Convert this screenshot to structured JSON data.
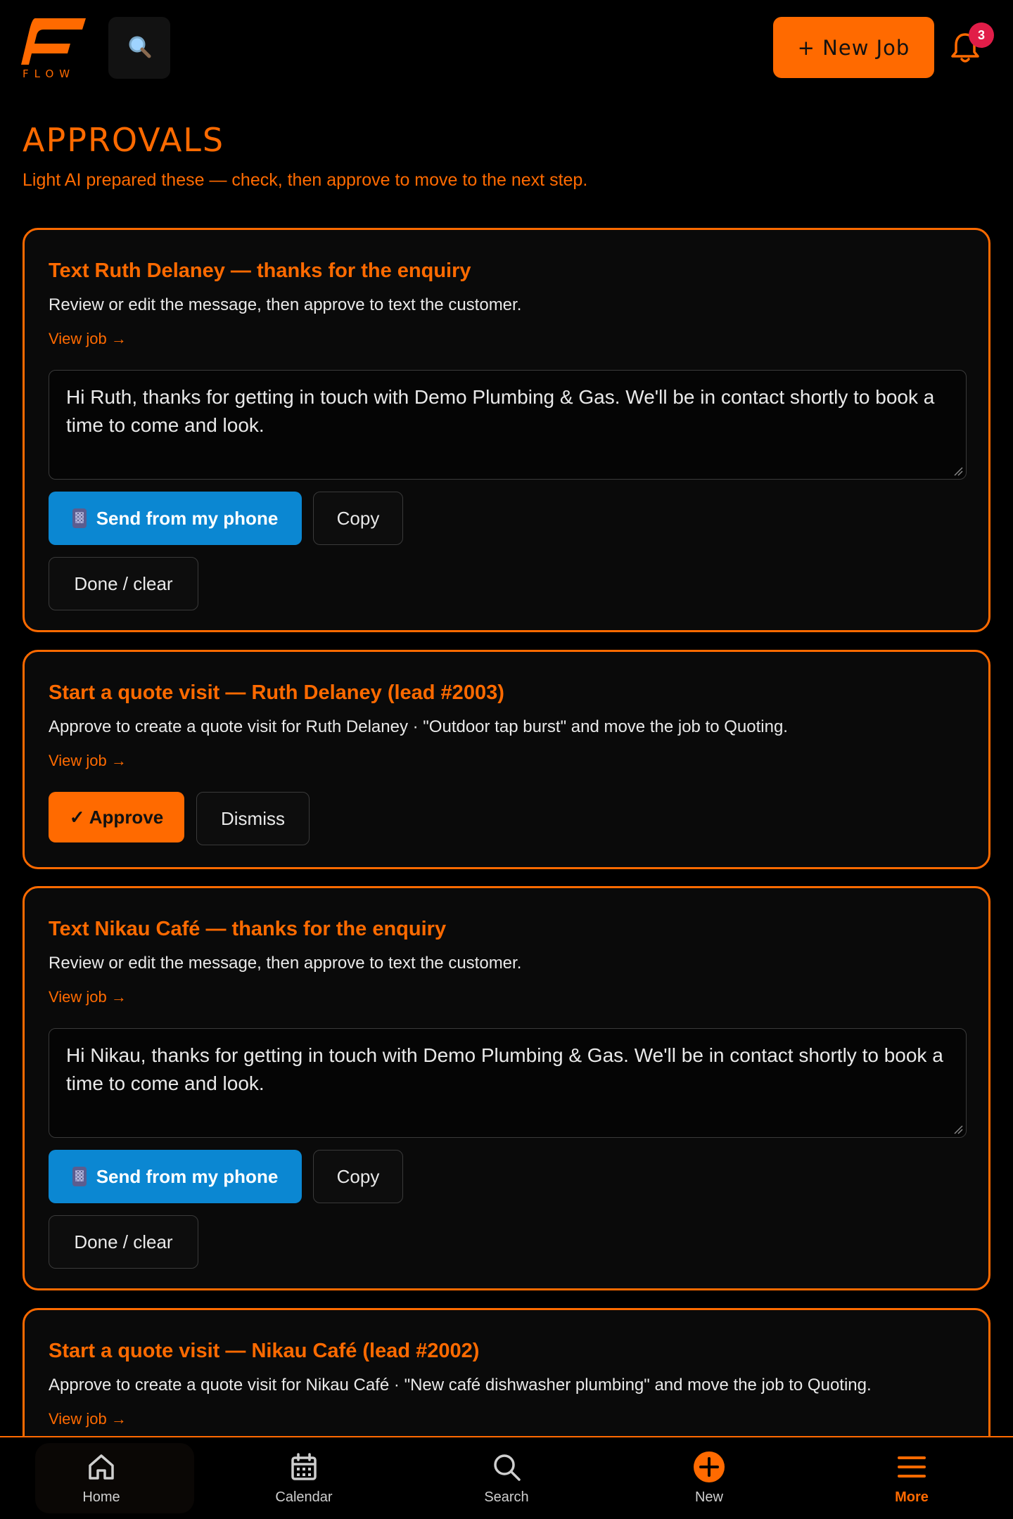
{
  "header": {
    "logo_text": "FLOW",
    "new_job_label": "+ New Job",
    "notification_count": "3"
  },
  "page": {
    "title": "APPROVALS",
    "subtitle": "Light AI prepared these — check, then approve to move to the next step."
  },
  "cards": [
    {
      "title": "Text Ruth Delaney — thanks for the enquiry",
      "description": "Review or edit the message, then approve to text the customer.",
      "view_job": "View job →",
      "message": "Hi Ruth, thanks for getting in touch with Demo Plumbing & Gas. We'll be in contact shortly to book a time to come and look.",
      "send_label": "Send from my phone",
      "copy_label": "Copy",
      "done_label": "Done / clear"
    },
    {
      "title": "Start a quote visit — Ruth Delaney (lead #2003)",
      "description": "Approve to create a quote visit for Ruth Delaney · \"Outdoor tap burst\" and move the job to Quoting.",
      "view_job": "View job →",
      "approve_label": "✓ Approve",
      "dismiss_label": "Dismiss"
    },
    {
      "title": "Text Nikau Café — thanks for the enquiry",
      "description": "Review or edit the message, then approve to text the customer.",
      "view_job": "View job →",
      "message": "Hi Nikau, thanks for getting in touch with Demo Plumbing & Gas. We'll be in contact shortly to book a time to come and look.",
      "send_label": "Send from my phone",
      "copy_label": "Copy",
      "done_label": "Done / clear"
    },
    {
      "title": "Start a quote visit — Nikau Café (lead #2002)",
      "description": "Approve to create a quote visit for Nikau Café · \"New café dishwasher plumbing\" and move the job to Quoting.",
      "view_job": "View job →"
    }
  ],
  "bottom_nav": {
    "items": [
      {
        "label": "Home",
        "icon": "home-icon"
      },
      {
        "label": "Calendar",
        "icon": "calendar-icon"
      },
      {
        "label": "Search",
        "icon": "search-icon"
      },
      {
        "label": "New",
        "icon": "plus-circle-icon"
      },
      {
        "label": "More",
        "icon": "menu-icon"
      }
    ]
  },
  "colors": {
    "accent": "#ff6a00",
    "send_button": "#0b87d2",
    "badge": "#e11d48"
  }
}
